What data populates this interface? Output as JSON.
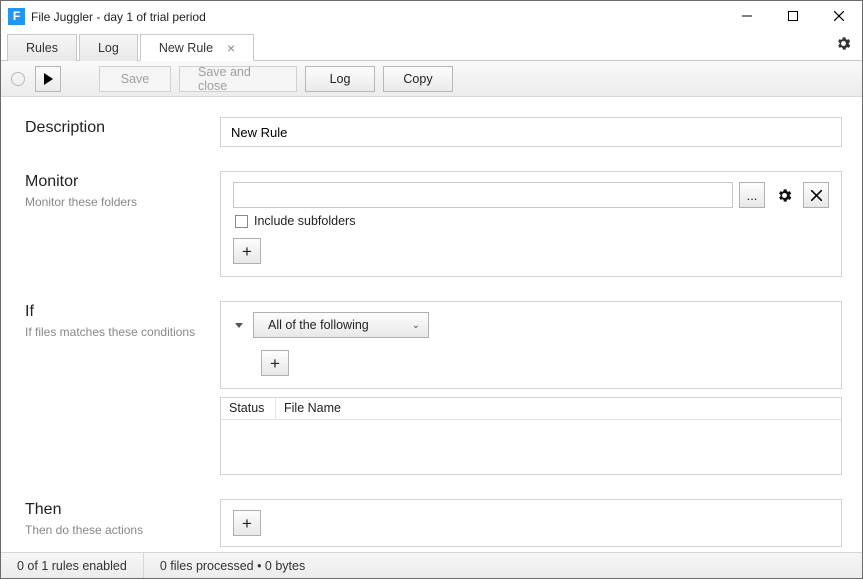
{
  "window": {
    "title": "File Juggler - day 1 of trial period"
  },
  "tabs": {
    "rules": "Rules",
    "log": "Log",
    "newrule": "New Rule"
  },
  "toolbar": {
    "save": "Save",
    "save_close": "Save and close",
    "log": "Log",
    "copy": "Copy"
  },
  "sections": {
    "description": {
      "title": "Description",
      "value": "New Rule"
    },
    "monitor": {
      "title": "Monitor",
      "sub": "Monitor these folders",
      "folder_value": "",
      "ellipsis": "...",
      "include_subfolders": "Include subfolders"
    },
    "if": {
      "title": "If",
      "sub": "If files matches these conditions",
      "combo": "All of the following",
      "col_status": "Status",
      "col_filename": "File Name"
    },
    "then": {
      "title": "Then",
      "sub": "Then do these actions"
    }
  },
  "status": {
    "rules": "0 of 1 rules enabled",
    "processed": "0 files processed • 0 bytes"
  }
}
